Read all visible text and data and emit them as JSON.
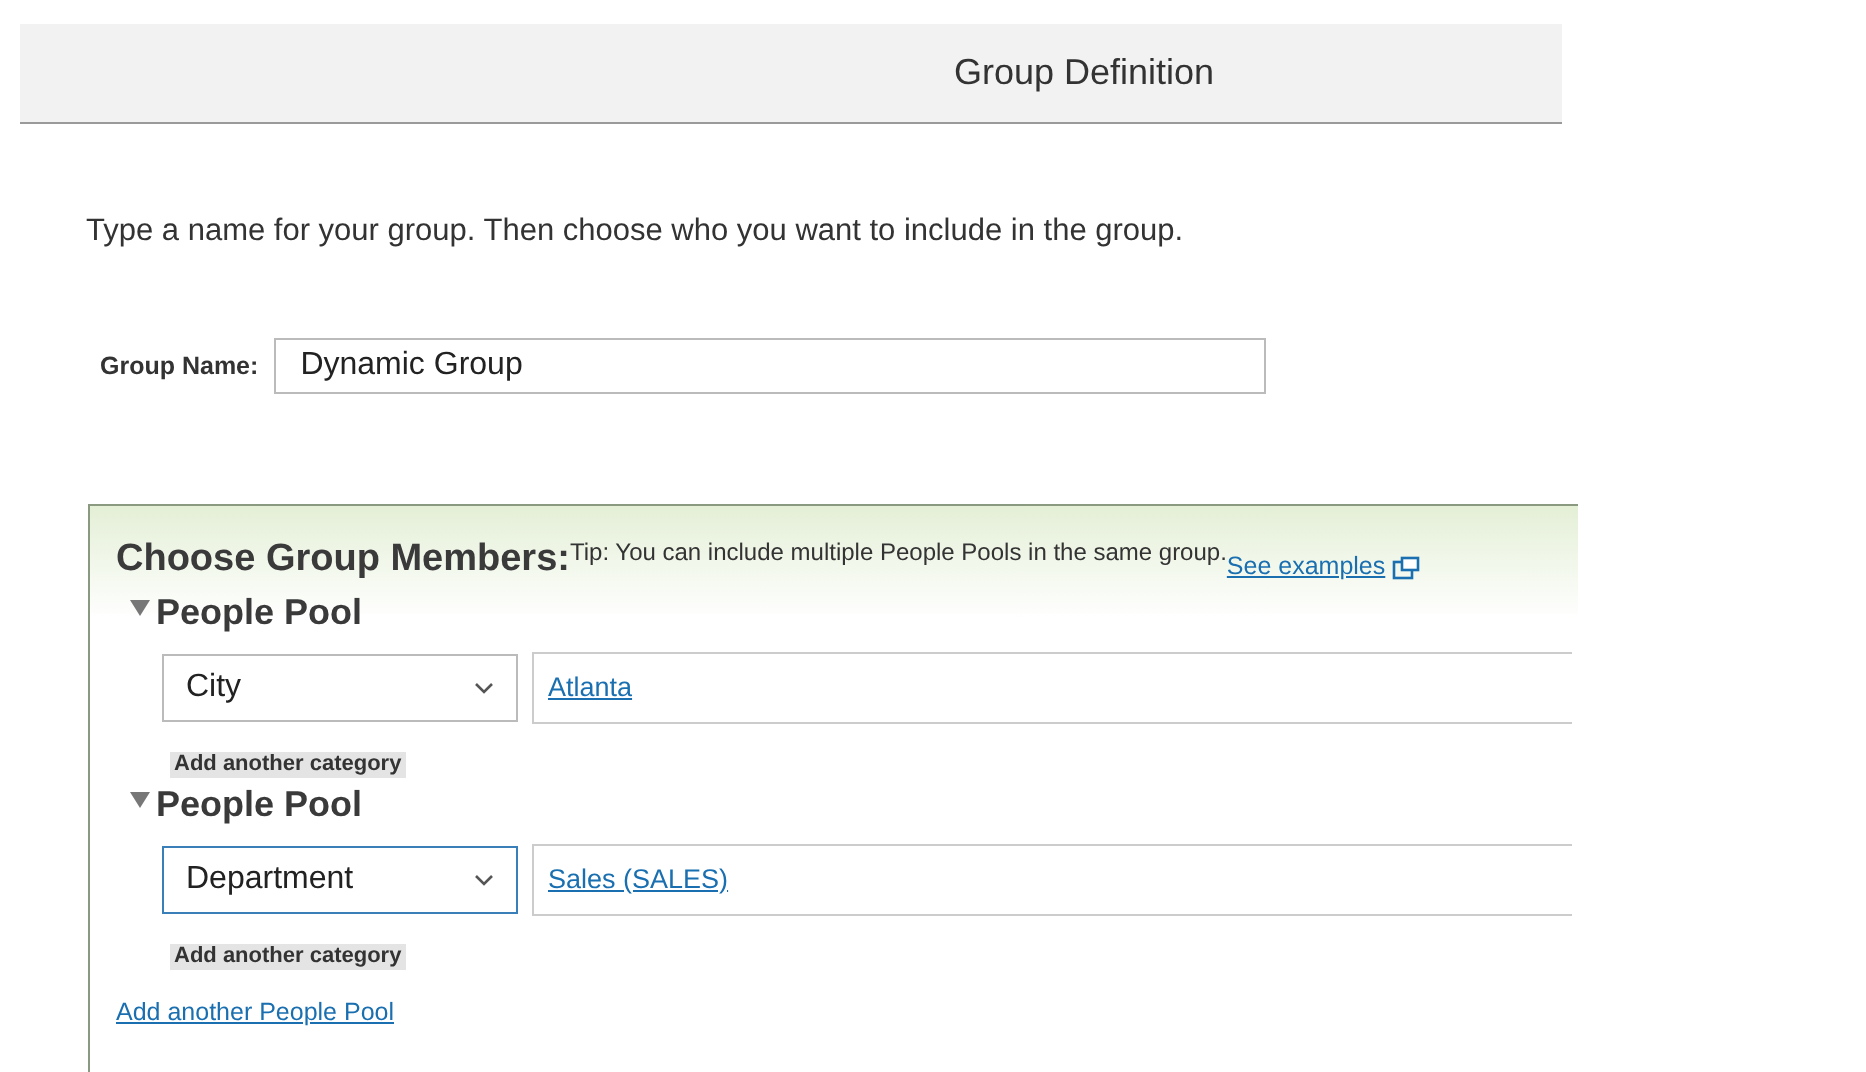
{
  "header": {
    "title": "Group Definition"
  },
  "intro": "Type a name for your group. Then choose who you want to include in the group.",
  "group_name": {
    "label": "Group Name:",
    "value": "Dynamic Group"
  },
  "members_panel": {
    "title": "Choose Group Members:",
    "tip": "Tip: You can include multiple People Pools in the same group.",
    "examples_link": "See examples",
    "pools": [
      {
        "heading": "People Pool",
        "expanded": true,
        "category": "City",
        "focused": false,
        "value_link": "Atlanta",
        "add_category": "Add another category"
      },
      {
        "heading": "People Pool",
        "expanded": true,
        "category": "Department",
        "focused": true,
        "value_link": "Sales (SALES)",
        "add_category": "Add another category"
      }
    ],
    "add_pool_link": "Add another People Pool"
  }
}
